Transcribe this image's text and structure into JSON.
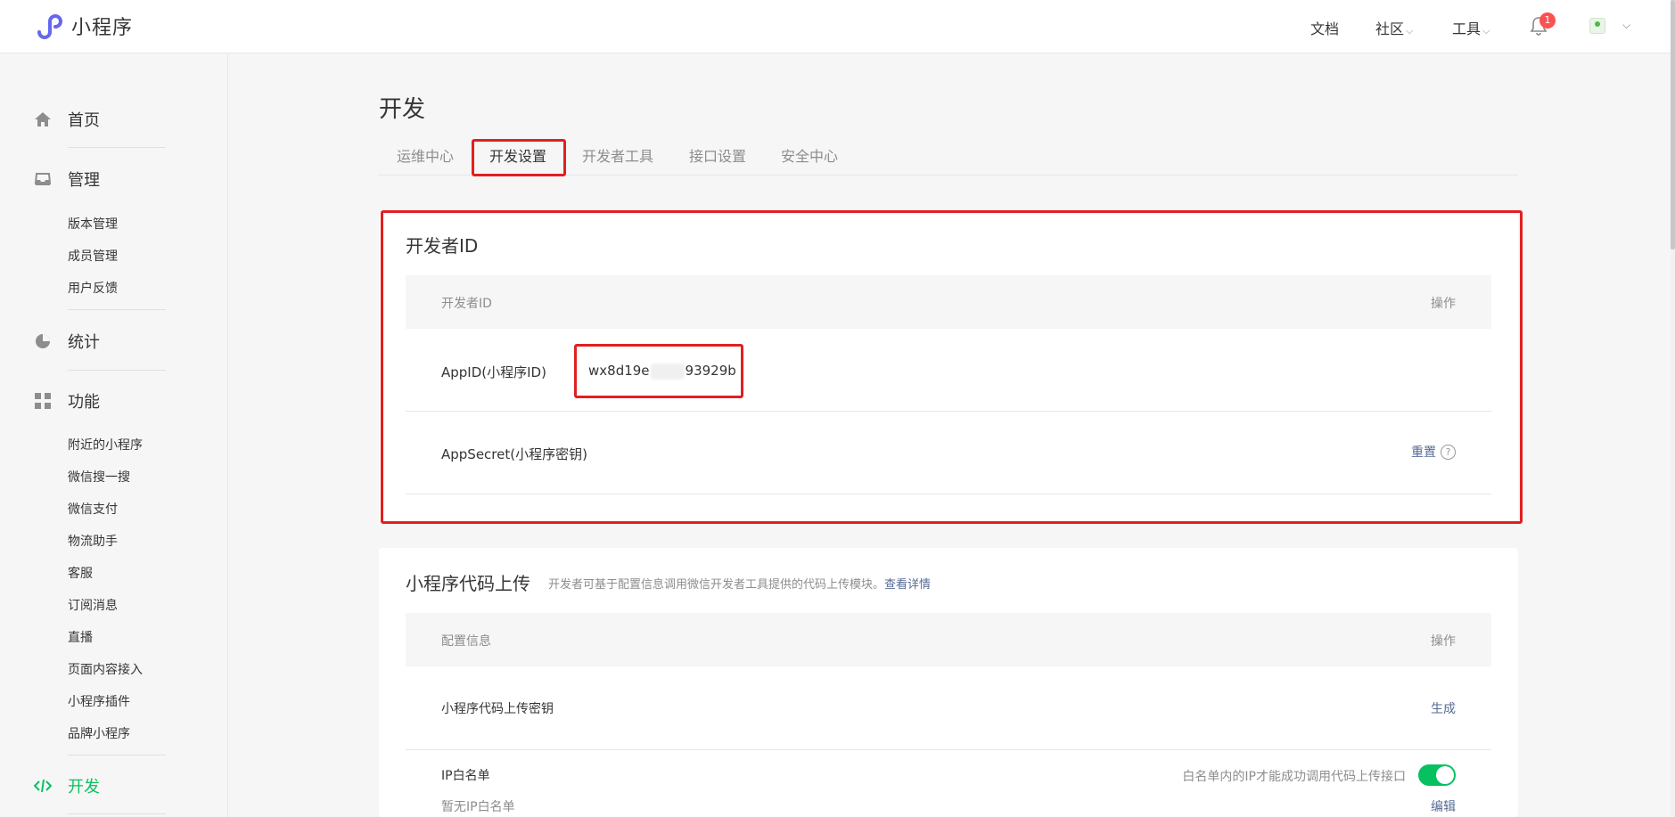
{
  "app": {
    "name": "小程序"
  },
  "topnav": {
    "docs": "文档",
    "community": "社区",
    "tools": "工具",
    "notification_count": "1"
  },
  "sidebar": {
    "home": "首页",
    "manage": "管理",
    "manage_items": [
      "版本管理",
      "成员管理",
      "用户反馈"
    ],
    "stats": "统计",
    "features": "功能",
    "feature_items": [
      "附近的小程序",
      "微信搜一搜",
      "微信支付",
      "物流助手",
      "客服",
      "订阅消息",
      "直播",
      "页面内容接入",
      "小程序插件",
      "品牌小程序"
    ],
    "develop": "开发"
  },
  "main": {
    "title": "开发",
    "tabs": [
      "运维中心",
      "开发设置",
      "开发者工具",
      "接口设置",
      "安全中心"
    ],
    "active_tab": "开发设置"
  },
  "developer_id": {
    "title": "开发者ID",
    "col_left": "开发者ID",
    "col_right": "操作",
    "appid_label": "AppID(小程序ID)",
    "appid_prefix": "wx8d19e",
    "appid_suffix": "93929b",
    "secret_label": "AppSecret(小程序密钥)",
    "secret_action": "重置",
    "help": "?"
  },
  "code_upload": {
    "title": "小程序代码上传",
    "desc": "开发者可基于配置信息调用微信开发者工具提供的代码上传模块。",
    "desc_link": "查看详情",
    "col_left": "配置信息",
    "col_right": "操作",
    "key_label": "小程序代码上传密钥",
    "key_action": "生成",
    "ip_label": "IP白名单",
    "ip_hint": "白名单内的IP才能成功调用代码上传接口",
    "ip_toggle_on": true,
    "ip_empty": "暂无IP白名单",
    "ip_action": "编辑"
  },
  "colors": {
    "accent": "#07c160",
    "link": "#576b95",
    "highlight": "#e02020"
  }
}
